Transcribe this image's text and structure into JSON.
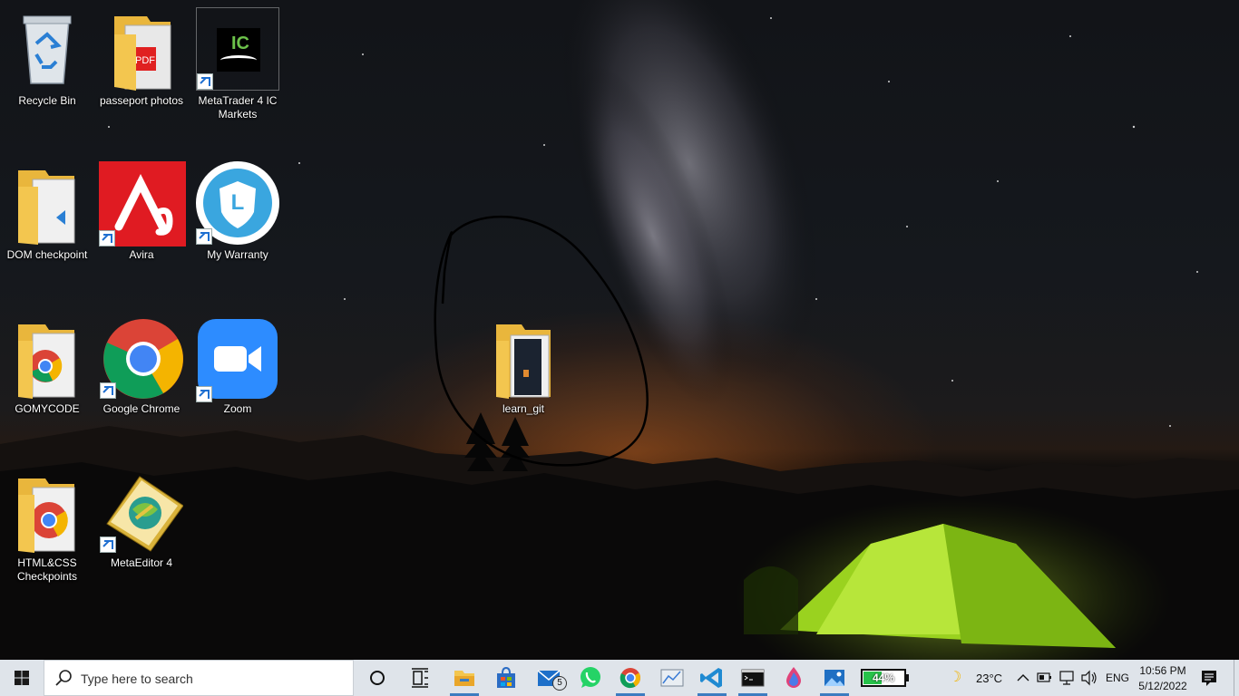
{
  "desktop": {
    "icons": [
      {
        "label": "Recycle Bin"
      },
      {
        "label": "passeport photos"
      },
      {
        "label": "MetaTrader 4 IC Markets",
        "logo_text": "IC"
      },
      {
        "label": "DOM checkpoint"
      },
      {
        "label": "Avira"
      },
      {
        "label": "My Warranty",
        "logo_text": "L"
      },
      {
        "label": "GOMYCODE"
      },
      {
        "label": "Google Chrome"
      },
      {
        "label": "Zoom"
      },
      {
        "label": "learn_git"
      },
      {
        "label": "HTML&CSS Checkpoints"
      },
      {
        "label": "MetaEditor 4"
      }
    ]
  },
  "taskbar": {
    "search_placeholder": "Type here to search",
    "mail_badge": "5",
    "battery_app_text": "44%",
    "weather": "23°C",
    "language": "ENG",
    "time": "10:56 PM",
    "date": "5/12/2022"
  },
  "colors": {
    "taskbar_bg": "#dfe4ea",
    "folder_yellow": "#f3c64f",
    "avira_red": "#e01b22",
    "zoom_blue": "#2d8cff",
    "warranty_blue": "#3aa6df",
    "tent_green": "#9ad21f"
  }
}
